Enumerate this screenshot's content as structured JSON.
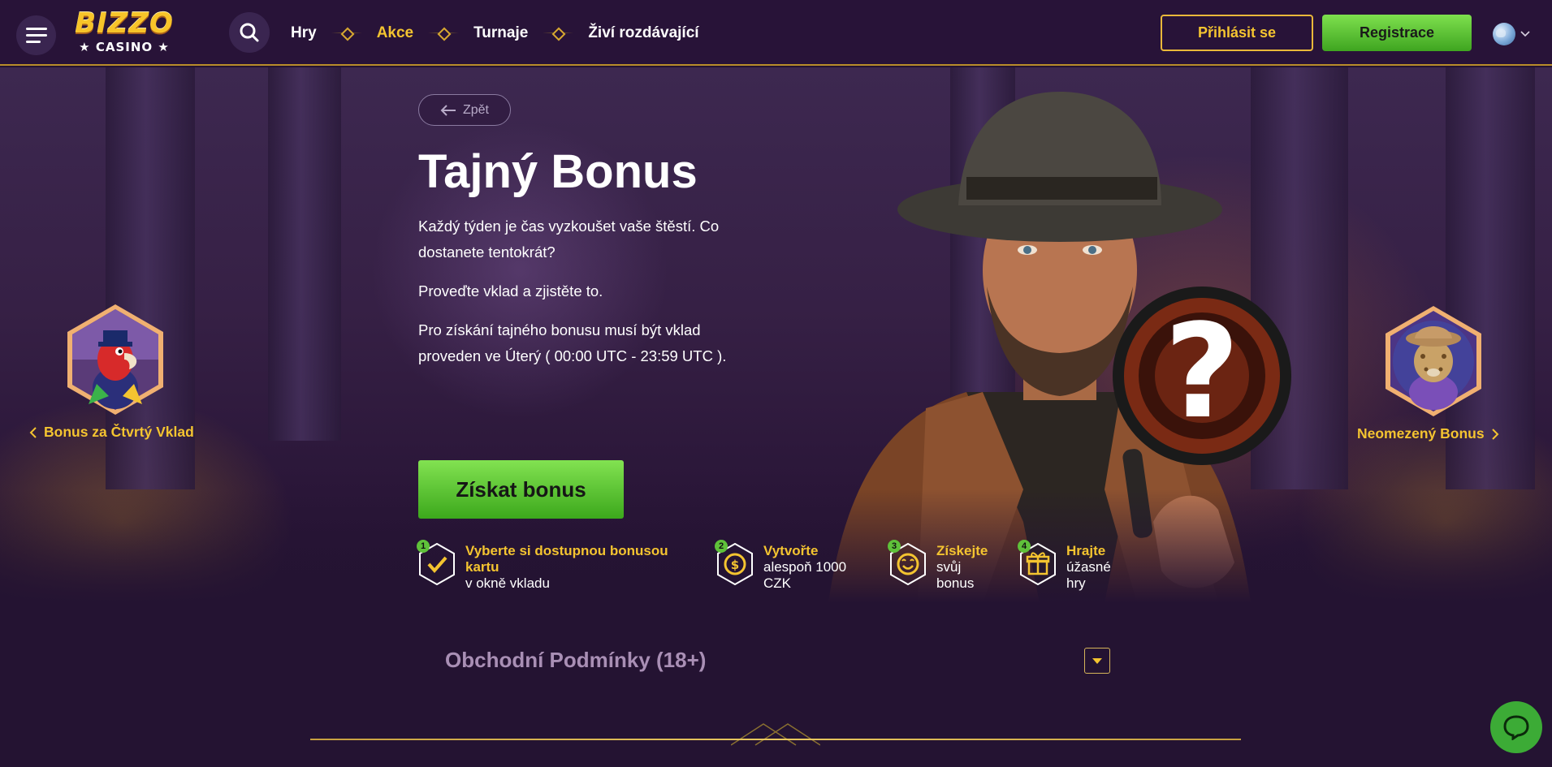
{
  "header": {
    "logo_top": "BIZZO",
    "logo_bottom": "★ CASINO ★",
    "nav": [
      {
        "label": "Hry",
        "active": false
      },
      {
        "label": "Akce",
        "active": true
      },
      {
        "label": "Turnaje",
        "active": false
      },
      {
        "label": "Živí rozdávající",
        "active": false
      }
    ],
    "login_label": "Přihlásit se",
    "register_label": "Registrace",
    "icons": {
      "menu": "hamburger-icon",
      "search": "search-icon",
      "language": "globe-icon",
      "language_chevron": "chevron-down-icon"
    }
  },
  "hero": {
    "back_label": "Zpět",
    "title": "Tajný Bonus",
    "text1": "Každý týden je čas vyzkoušet vaše štěstí. Co dostanete tentokrát?",
    "text2": "Proveďte vklad a zjistěte to.",
    "text3": "Pro získání tajného bonusu musí být vklad proveden ve Úterý ( 00:00 UTC - 23:59 UTC ).",
    "cta_label": "Získat bonus",
    "prev_bonus": "Bonus za Čtvrtý Vklad",
    "next_bonus": "Neomezený Bonus"
  },
  "steps": [
    {
      "num": "1",
      "strong": "Vyberte si dostupnou bonusou kartu",
      "normal": "v okně vkladu",
      "icon": "check-icon"
    },
    {
      "num": "2",
      "strong": "Vytvořte",
      "normal": "alespoň 1000 CZK",
      "icon": "coin-icon"
    },
    {
      "num": "3",
      "strong": "Získejte",
      "normal": "svůj bonus",
      "icon": "smile-icon"
    },
    {
      "num": "4",
      "strong": "Hrajte",
      "normal": "úžasné hry",
      "icon": "gift-icon"
    }
  ],
  "terms": {
    "title": "Obchodní Podmínky (18+)"
  },
  "colors": {
    "accent_gold": "#f4c430",
    "cta_green": "#5fc13a",
    "background": "#241332",
    "header": "#281338"
  }
}
